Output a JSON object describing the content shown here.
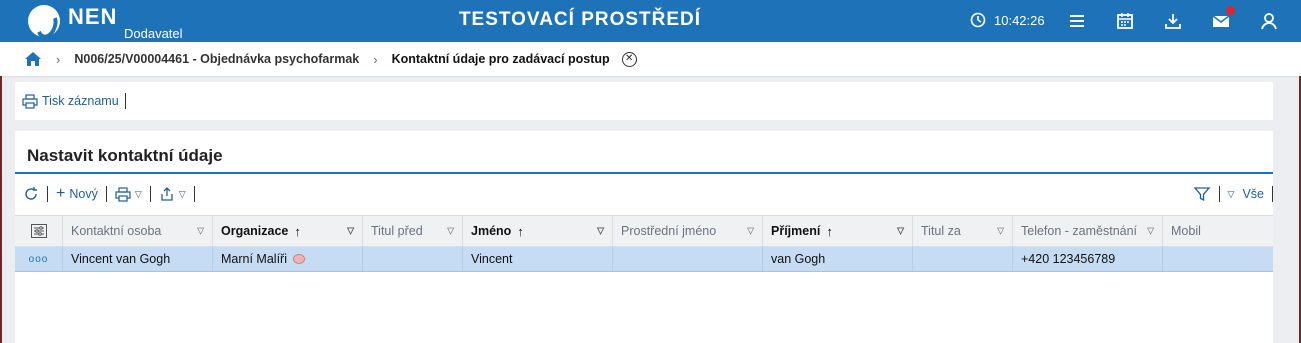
{
  "header": {
    "logo_text": "NEN",
    "logo_sub": "Dodavatel",
    "environment": "TESTOVACÍ PROSTŘEDÍ",
    "time": "10:42:26",
    "icons": [
      "clock-icon",
      "menu-icon",
      "calendar-icon",
      "download-icon",
      "mail-icon",
      "user-icon"
    ]
  },
  "breadcrumb": {
    "items": [
      "N006/25/V00004461 - Objednávka psychofarmak",
      "Kontaktní údaje pro zadávací postup"
    ]
  },
  "print_panel": {
    "print_label": "Tisk záznamu"
  },
  "panel": {
    "title": "Nastavit kontaktní údaje",
    "toolbar": {
      "new_label": "Nový",
      "filter_all_label": "Vše"
    }
  },
  "table": {
    "columns": [
      "Kontaktní osoba",
      "Organizace",
      "Titul před",
      "Jméno",
      "Prostřední jméno",
      "Příjmení",
      "Titul za",
      "Telefon - zaměstnání",
      "Mobil"
    ],
    "sorted_columns": [
      "Organizace",
      "Jméno",
      "Příjmení"
    ],
    "rows": [
      {
        "row_menu": "ooo",
        "contact_person": "Vincent van Gogh",
        "organization": "Marní Malíři",
        "title_before": "",
        "first_name": "Vincent",
        "middle_name": "",
        "surname": "van Gogh",
        "title_after": "",
        "phone": "+420 123456789",
        "mobile": ""
      }
    ]
  },
  "colors": {
    "header_blue": "#1e73b8",
    "row_selected": "#c5dcf3",
    "notification": "#e0242a"
  }
}
